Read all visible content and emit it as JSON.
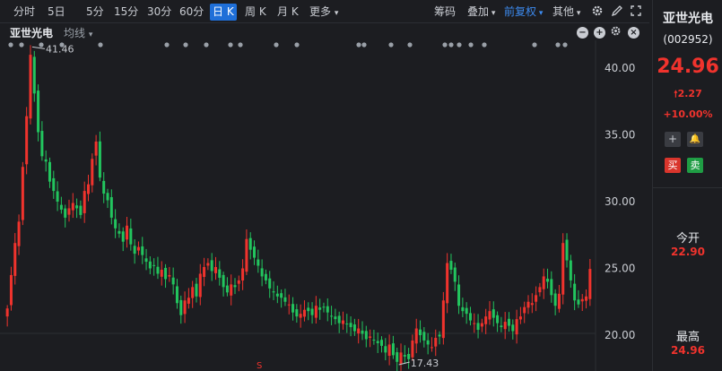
{
  "toolbar": {
    "periods": [
      "分时",
      "5日",
      "5分",
      "15分",
      "30分",
      "60分",
      "日 K",
      "周 K",
      "月 K",
      "更多"
    ],
    "active_period": "日 K",
    "more_arrow": "▾",
    "chips": "筹码",
    "overlay": "叠加",
    "adjust": "前复权",
    "other": "其他",
    "icons": [
      "settings-icon",
      "pencil-icon",
      "expand-icon"
    ]
  },
  "subbar": {
    "stock_name": "亚世光电",
    "ma_label": "均线",
    "ma_arrow": "▾"
  },
  "panel": {
    "name": "亚世光电",
    "code": "(002952)",
    "price": "24.96",
    "change": "2.27",
    "change_arrow": "🠕",
    "pct": "+10.00%",
    "add_label": "+",
    "alert_label": "🔔",
    "buy_label": "买",
    "sell_label": "卖",
    "open_label": "今开",
    "open_value": "22.90",
    "high_label": "最高",
    "high_value": "24.96"
  },
  "colors": {
    "up": "#f0332d",
    "down": "#22c55e",
    "accent": "#1f6fd8",
    "bg": "#1c1d21"
  },
  "chart_data": {
    "type": "candlestick",
    "y_ticks": [
      "40.00",
      "35.00",
      "30.00",
      "25.00",
      "20.00"
    ],
    "ylim": [
      17.0,
      42.0
    ],
    "annotations": [
      {
        "label": "41.46",
        "kind": "max"
      },
      {
        "label": "17.43",
        "kind": "min"
      }
    ],
    "marker": "S",
    "closes": [
      22.0,
      24.5,
      26.9,
      28.5,
      32.6,
      36.4,
      41.0,
      38.1,
      35.2,
      33.4,
      33.0,
      31.5,
      30.8,
      30.0,
      29.4,
      28.8,
      29.5,
      29.9,
      29.5,
      29.0,
      30.8,
      31.3,
      33.2,
      34.5,
      31.8,
      30.6,
      30.1,
      28.8,
      28.0,
      27.6,
      27.0,
      28.2,
      26.8,
      26.1,
      26.6,
      26.0,
      25.5,
      25.0,
      25.2,
      24.6,
      24.9,
      24.2,
      24.5,
      23.8,
      22.4,
      21.5,
      22.6,
      22.8,
      23.6,
      22.9,
      24.6,
      25.1,
      25.4,
      24.8,
      25.1,
      24.3,
      23.6,
      23.2,
      23.8,
      23.6,
      24.1,
      25.0,
      27.2,
      26.4,
      25.8,
      25.2,
      24.4,
      24.1,
      23.5,
      23.2,
      22.9,
      22.8,
      22.5,
      22.3,
      21.7,
      21.4,
      21.6,
      21.9,
      21.8,
      21.5,
      22.2,
      21.9,
      22.1,
      21.7,
      21.4,
      21.2,
      20.9,
      21.1,
      20.8,
      20.6,
      20.3,
      20.5,
      20.1,
      19.7,
      19.9,
      19.6,
      19.4,
      19.2,
      18.7,
      19.3,
      18.5,
      18.0,
      18.7,
      18.4,
      18.2,
      19.6,
      20.5,
      20.0,
      19.6,
      19.3,
      19.1,
      19.8,
      19.9,
      22.6,
      25.4,
      24.9,
      24.0,
      22.2,
      21.8,
      21.6,
      21.1,
      20.9,
      20.4,
      20.9,
      21.4,
      21.8,
      21.3,
      20.9,
      20.6,
      21.0,
      20.7,
      20.3,
      21.2,
      21.4,
      22.1,
      22.5,
      22.4,
      23.0,
      23.6,
      24.4,
      24.0,
      23.0,
      22.2,
      23.1,
      26.9,
      25.6,
      24.1,
      22.6,
      22.3,
      22.7,
      22.9,
      24.96
    ]
  }
}
